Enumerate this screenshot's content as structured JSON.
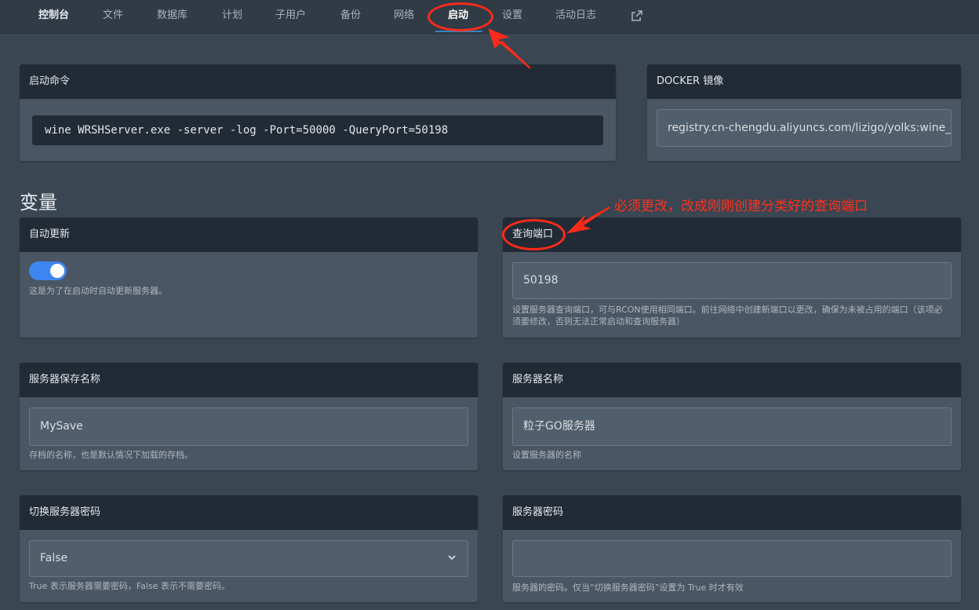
{
  "nav": {
    "items": [
      "控制台",
      "文件",
      "数据库",
      "计划",
      "子用户",
      "备份",
      "网络",
      "启动",
      "设置",
      "活动日志"
    ],
    "external_icon": "external-link-icon"
  },
  "startup": {
    "title": "启动命令",
    "command": "wine WRSHServer.exe -server -log -Port=50000 -QueryPort=50198"
  },
  "docker": {
    "title": "DOCKER 镜像",
    "value": "registry.cn-chengdu.aliyuncs.com/lizigo/yolks:wine_s"
  },
  "variables": {
    "heading": "变量",
    "auto_update": {
      "title": "自动更新",
      "enabled": true,
      "desc": "这是为了在启动时自动更新服务器。"
    },
    "query_port": {
      "title": "查询端口",
      "value": "50198",
      "desc": "设置服务器查询端口，可与RCON使用相同端口。前往网络中创建新端口以更改，确保为未被占用的端口（该项必须要修改，否则无法正常启动和查询服务器）"
    },
    "save_name": {
      "title": "服务器保存名称",
      "value": "MySave",
      "desc": "存档的名称，也是默认情况下加载的存档。"
    },
    "server_name": {
      "title": "服务器名称",
      "value": "粒子GO服务器",
      "desc": "设置服务器的名称"
    },
    "toggle_password": {
      "title": "切换服务器密码",
      "value": "False",
      "desc": "True 表示服务器需要密码，False 表示不需要密码。"
    },
    "server_password": {
      "title": "服务器密码",
      "value": "",
      "desc": "服务器的密码。仅当“切换服务器密码”设置为 True 时才有效"
    }
  },
  "annotation": {
    "text": "必须更改，改成刚刚创建分类好的查询端口",
    "color": "#ff2a1a"
  },
  "colors": {
    "accent": "#3d86f0",
    "panel_header": "#222b35",
    "panel_body": "#4a5663",
    "background": "#3a4651"
  }
}
